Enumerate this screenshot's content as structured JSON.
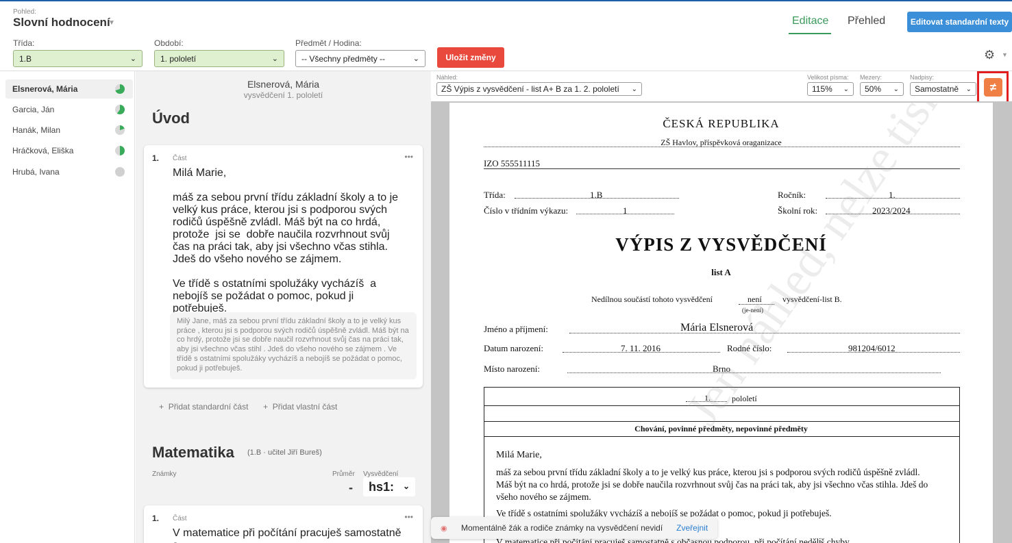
{
  "header": {
    "view_label": "Pohled:",
    "view_title": "Slovní hodnocení",
    "tabs": [
      {
        "label": "Editace",
        "active": true
      },
      {
        "label": "Přehled",
        "active": false
      }
    ],
    "edit_std_button": "Editovat standardní texty",
    "trida_label": "Třída:",
    "trida_value": "1.B",
    "obdobi_label": "Období:",
    "obdobi_value": "1. pololetí",
    "predmet_label": "Předmět / Hodina:",
    "predmet_value": "-- Všechny předměty --",
    "save_button": "Uložit změny"
  },
  "students": [
    {
      "name": "Elsnerová, Mária",
      "active": true,
      "progress": 0.7
    },
    {
      "name": "Garcia, Ján",
      "active": false,
      "progress": 0.6
    },
    {
      "name": "Hanák, Milan",
      "active": false,
      "progress": 0.2
    },
    {
      "name": "Hráčková, Eliška",
      "active": false,
      "progress": 0.5
    },
    {
      "name": "Hrubá, Ivana",
      "active": false,
      "progress": 0
    }
  ],
  "editor": {
    "student_name": "Elsnerová, Mária",
    "subtitle": "vysvědčení 1. pololetí",
    "section_uvod": "Úvod",
    "card1": {
      "num": "1.",
      "part_label": "Část",
      "text": "Milá Marie,\n\nmáš za sebou první třídu základní školy a to je velký kus práce, kterou jsi s podporou svých rodičů úspěšně zvládl. Máš být na co hrdá, protože  jsi se  dobře naučila rozvrhnout svůj čas na práci tak, aby jsi všechno včas stihla. Jdeš do všeho nového se zájmem.\n\nVe třídě s ostatními spolužáky vycházíš  a nebojíš se požádat o pomoc, pokud ji potřebuješ.",
      "original": "Milý Jane, máš za sebou první třídu základní školy a to je velký kus práce , kterou jsi s podporou svých rodičů úspěšně zvládl. Máš být na co hrdý, protože  jsi se  dobře naučil rozvrhnout svůj čas na práci tak, aby jsi všechno včas stihl . Jdeš do všeho nového se zájmem . Ve třídě s ostatními spolužáky vycházíš  a nebojíš se požádat o pomoc, pokud ji potřebuješ."
    },
    "add_standard": "Přidat standardní část",
    "add_own": "Přidat vlastní část",
    "section_math": "Matematika",
    "math_sub": "(1.B · učitel Jiří Bureš)",
    "znamky_label": "Známky",
    "prumer_label": "Průměr",
    "vysvedceni_label": "Vysvědčení",
    "prumer_value": "-",
    "vysvedceni_value": "hs1:",
    "card2": {
      "num": "1.",
      "part_label": "Část",
      "text": "V matematice při počítání pracuješ samostatně s"
    }
  },
  "preview": {
    "nahled_label": "Náhled:",
    "nahled_value": "ZŠ Výpis z vysvědčení - list A+ B za 1. 2. pololetí",
    "velikost_label": "Velikost písma:",
    "velikost_value": "115%",
    "mezery_label": "Mezery:",
    "mezery_value": "50%",
    "nadpisy_label": "Nadpisy:",
    "nadpisy_value": "Samostatně",
    "diff_icon": "not-equal-icon"
  },
  "document": {
    "country": "ČESKÁ REPUBLIKA",
    "school": "ZŠ Havlov, příspěvková oraganizace",
    "izo": "IZO  555511115",
    "trida_label": "Třída:",
    "trida_value": "1.B",
    "rocnik_label": "Ročník:",
    "rocnik_value": "1.",
    "cislo_label": "Číslo v třídním výkazu:",
    "cislo_value": "1",
    "rok_label": "Školní rok:",
    "rok_value": "2023/2024",
    "title": "VÝPIS Z VYSVĚDČENÍ",
    "list": "list A",
    "nedilnou_pre": "Nedílnou součástí tohoto vysvědčení",
    "nedilnou_value": "není",
    "nedilnou_hint": "(je-není)",
    "nedilnou_post": "vysvědčení-list B.",
    "jmeno_label": "Jméno a příjmení:",
    "jmeno_value": "Mária Elsnerová",
    "datum_label": "Datum narození:",
    "datum_value": "7. 11. 2016",
    "rc_label": "Rodné číslo:",
    "rc_value": "981204/6012",
    "misto_label": "Místo narození:",
    "misto_value": "Brno",
    "pololeti_num": "1.",
    "pololeti_label": "pololetí",
    "table_head": "Chování, povinné předměty, nepovinné předměty",
    "body_greeting": "Milá Marie,",
    "body_p1": "máš za sebou první třídu základní školy a to je velký kus práce, kterou jsi s podporou svých rodičů úspěšně zvládl. Máš být na co hrdá, protože  jsi se  dobře naučila rozvrhnout svůj čas na práci tak, aby jsi všechno včas stihla. Jdeš do všeho nového se zájmem.",
    "body_p2": "Ve třídě s ostatními spolužáky vycházíš  a nebojíš se požádat o pomoc, pokud ji potřebuješ.",
    "body_p3": "V matematice při počítání pracuješ samostatně s občasnou podporou, při počítání nedělᎥš chyby",
    "watermark": "Jen náhled, nelze tisknout"
  },
  "toast": {
    "text": "Momentálně žák a rodiče známky na vysvědčení nevidí",
    "link": "Zveřejnit"
  },
  "colors": {
    "accent_green": "#3a9a5b",
    "blue_button": "#3a8fd8",
    "red_button": "#e8493c",
    "orange_button": "#f07f45",
    "highlight_red": "#e02020"
  }
}
